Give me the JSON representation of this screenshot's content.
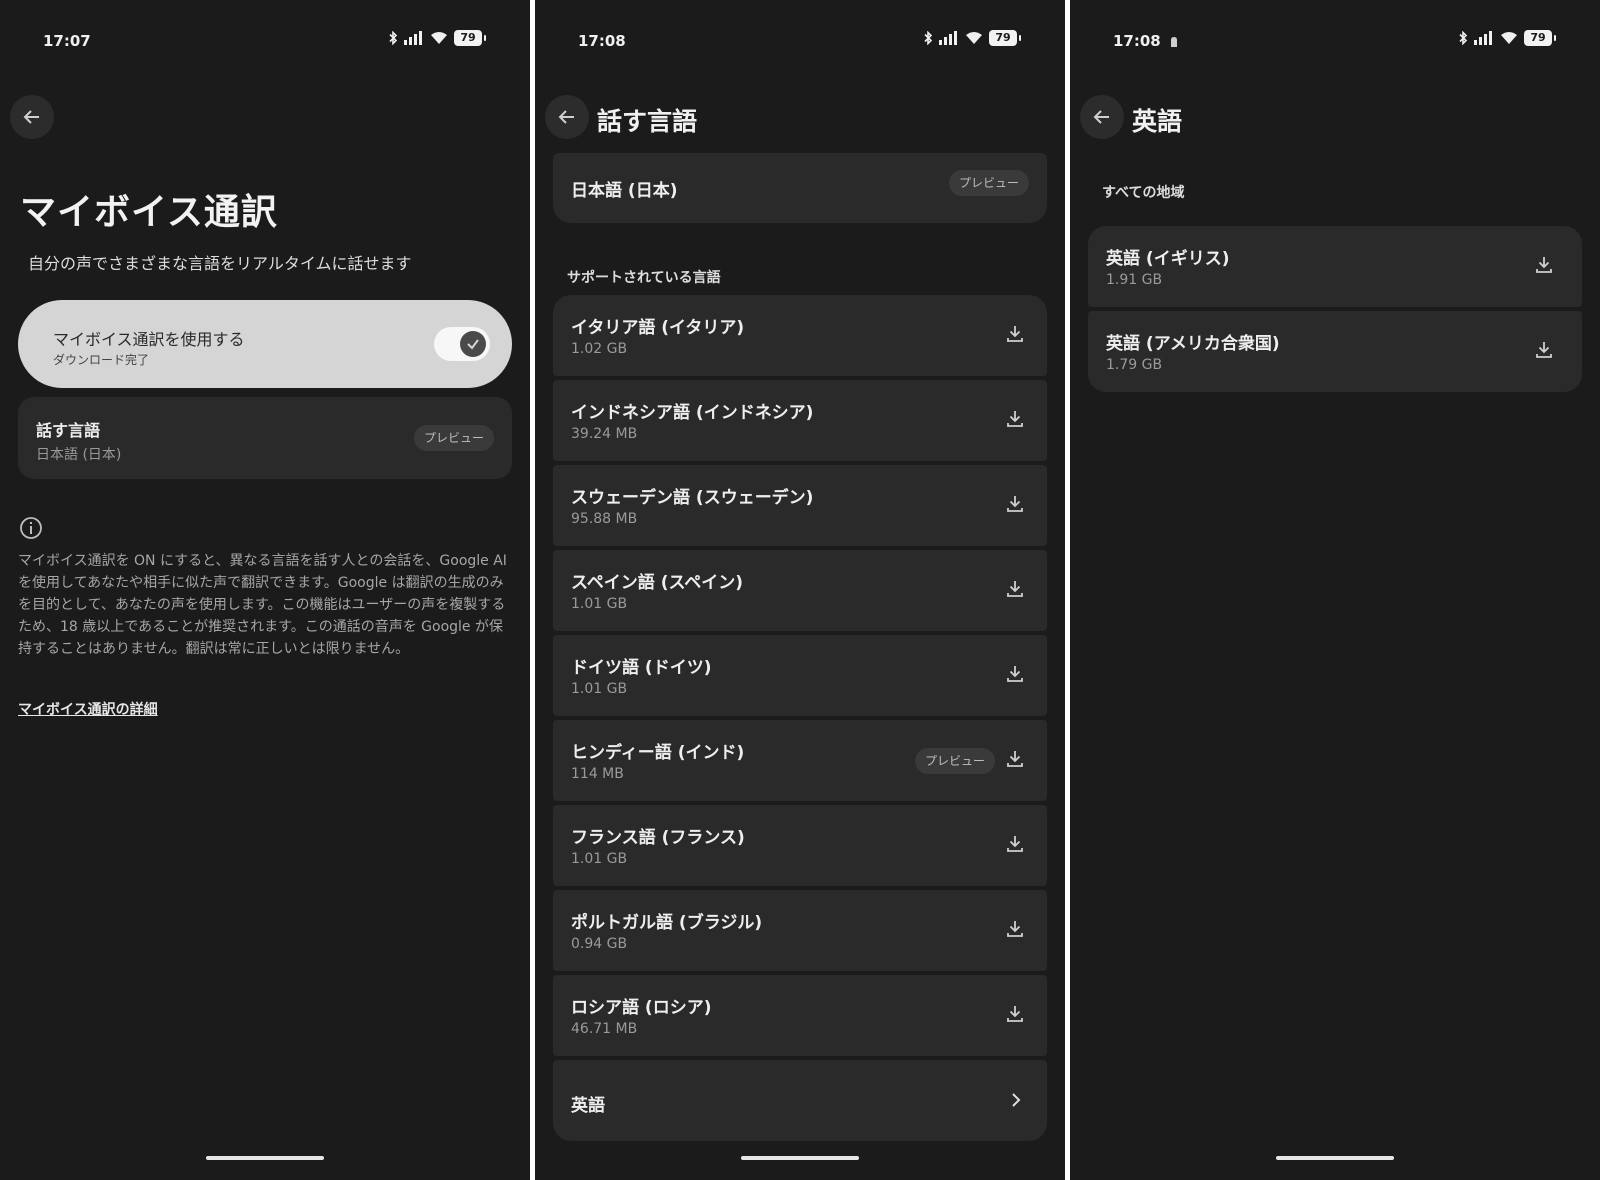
{
  "screens": [
    {
      "status": {
        "time": "17:07",
        "battery": "79"
      },
      "title": "マイボイス通訳",
      "subtitle": "自分の声でさまざまな言語をリアルタイムに話せます",
      "toggle": {
        "label": "マイボイス通訳を使用する",
        "status": "ダウンロード完了",
        "on": true
      },
      "language_card": {
        "label": "話す言語",
        "value": "日本語 (日本)",
        "badge": "プレビュー"
      },
      "info": "マイボイス通訳を ON にすると、異なる言語を話す人との会話を、Google AI を使用してあなたや相手に似た声で翻訳できます。Google は翻訳の生成のみを目的として、あなたの声を使用します。この機能はユーザーの声を複製するため、18 歳以上であることが推奨されます。この通話の音声を Google が保持することはありません。翻訳は常に正しいとは限りません。",
      "link": "マイボイス通訳の詳細"
    },
    {
      "status": {
        "time": "17:08",
        "battery": "79"
      },
      "title": "話す言語",
      "current": {
        "name": "日本語 (日本)",
        "badge": "プレビュー"
      },
      "section": "サポートされている言語",
      "languages": [
        {
          "name": "イタリア語 (イタリア)",
          "size": "1.02 GB"
        },
        {
          "name": "インドネシア語 (インドネシア)",
          "size": "39.24 MB"
        },
        {
          "name": "スウェーデン語 (スウェーデン)",
          "size": "95.88 MB"
        },
        {
          "name": "スペイン語 (スペイン)",
          "size": "1.01 GB"
        },
        {
          "name": "ドイツ語 (ドイツ)",
          "size": "1.01 GB"
        },
        {
          "name": "ヒンディー語 (インド)",
          "size": "114 MB",
          "badge": "プレビュー"
        },
        {
          "name": "フランス語 (フランス)",
          "size": "1.01 GB"
        },
        {
          "name": "ポルトガル語 (ブラジル)",
          "size": "0.94 GB"
        },
        {
          "name": "ロシア語 (ロシア)",
          "size": "46.71 MB"
        }
      ],
      "english": "英語"
    },
    {
      "status": {
        "time": "17:08",
        "battery": "79"
      },
      "title": "英語",
      "section": "すべての地域",
      "languages": [
        {
          "name": "英語 (イギリス)",
          "size": "1.91 GB"
        },
        {
          "name": "英語 (アメリカ合衆国)",
          "size": "1.79 GB"
        }
      ]
    }
  ]
}
